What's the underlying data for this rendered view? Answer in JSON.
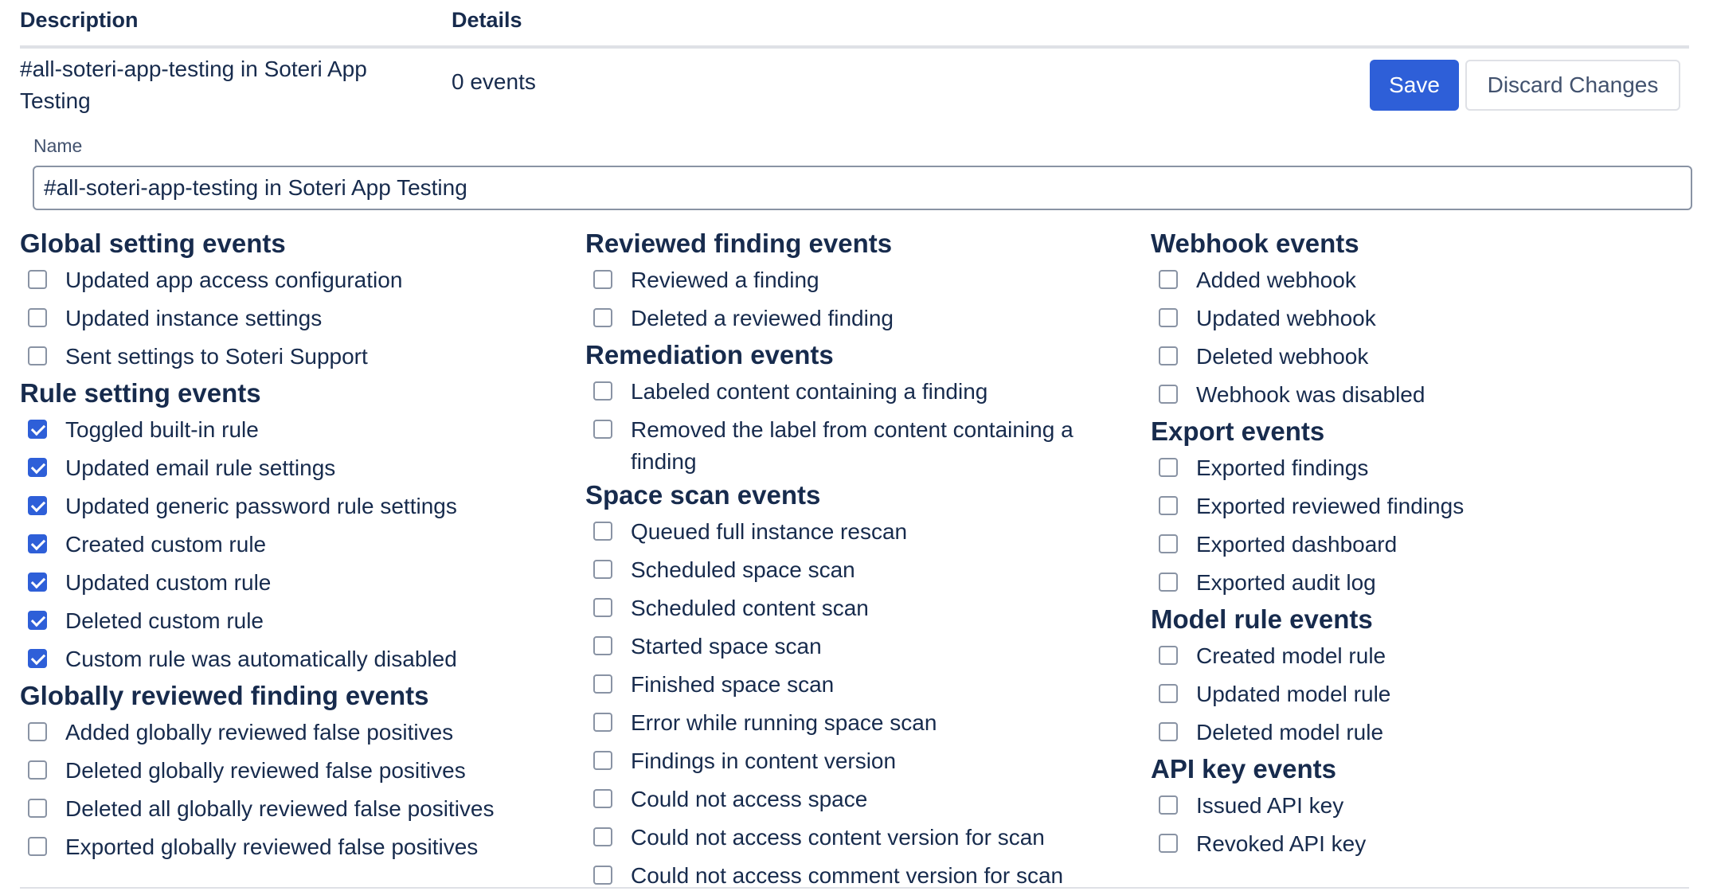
{
  "table": {
    "header_description": "Description",
    "header_details": "Details"
  },
  "row": {
    "description": "#all-soteri-app-testing in Soteri App Testing",
    "details": "0 events",
    "save_label": "Save",
    "discard_label": "Discard Changes"
  },
  "name_field": {
    "label": "Name",
    "value": "#all-soteri-app-testing in Soteri App Testing"
  },
  "accent_color": "#2e5fd8",
  "groups": {
    "global_setting": {
      "title": "Global setting events",
      "items": [
        {
          "label": "Updated app access configuration",
          "checked": false
        },
        {
          "label": "Updated instance settings",
          "checked": false
        },
        {
          "label": "Sent settings to Soteri Support",
          "checked": false
        }
      ]
    },
    "rule_setting": {
      "title": "Rule setting events",
      "items": [
        {
          "label": "Toggled built-in rule",
          "checked": true
        },
        {
          "label": "Updated email rule settings",
          "checked": true
        },
        {
          "label": "Updated generic password rule settings",
          "checked": true
        },
        {
          "label": "Created custom rule",
          "checked": true
        },
        {
          "label": "Updated custom rule",
          "checked": true
        },
        {
          "label": "Deleted custom rule",
          "checked": true
        },
        {
          "label": "Custom rule was automatically disabled",
          "checked": true
        }
      ]
    },
    "globally_reviewed": {
      "title": "Globally reviewed finding events",
      "items": [
        {
          "label": "Added globally reviewed false positives",
          "checked": false
        },
        {
          "label": "Deleted globally reviewed false positives",
          "checked": false
        },
        {
          "label": "Deleted all globally reviewed false positives",
          "checked": false
        },
        {
          "label": "Exported globally reviewed false positives",
          "checked": false
        }
      ]
    },
    "reviewed_finding": {
      "title": "Reviewed finding events",
      "items": [
        {
          "label": "Reviewed a finding",
          "checked": false
        },
        {
          "label": "Deleted a reviewed finding",
          "checked": false
        }
      ]
    },
    "remediation": {
      "title": "Remediation events",
      "items": [
        {
          "label": "Labeled content containing a finding",
          "checked": false
        },
        {
          "label": "Removed the label from content containing a finding",
          "checked": false
        }
      ]
    },
    "space_scan": {
      "title": "Space scan events",
      "items": [
        {
          "label": "Queued full instance rescan",
          "checked": false
        },
        {
          "label": "Scheduled space scan",
          "checked": false
        },
        {
          "label": "Scheduled content scan",
          "checked": false
        },
        {
          "label": "Started space scan",
          "checked": false
        },
        {
          "label": "Finished space scan",
          "checked": false
        },
        {
          "label": "Error while running space scan",
          "checked": false
        },
        {
          "label": "Findings in content version",
          "checked": false
        },
        {
          "label": "Could not access space",
          "checked": false
        },
        {
          "label": "Could not access content version for scan",
          "checked": false
        },
        {
          "label": "Could not access comment version for scan",
          "checked": false
        }
      ]
    },
    "webhook": {
      "title": "Webhook events",
      "items": [
        {
          "label": "Added webhook",
          "checked": false
        },
        {
          "label": "Updated webhook",
          "checked": false
        },
        {
          "label": "Deleted webhook",
          "checked": false
        },
        {
          "label": "Webhook was disabled",
          "checked": false
        }
      ]
    },
    "export": {
      "title": "Export events",
      "items": [
        {
          "label": "Exported findings",
          "checked": false
        },
        {
          "label": "Exported reviewed findings",
          "checked": false
        },
        {
          "label": "Exported dashboard",
          "checked": false
        },
        {
          "label": "Exported audit log",
          "checked": false
        }
      ]
    },
    "model_rule": {
      "title": "Model rule events",
      "items": [
        {
          "label": "Created model rule",
          "checked": false
        },
        {
          "label": "Updated model rule",
          "checked": false
        },
        {
          "label": "Deleted model rule",
          "checked": false
        }
      ]
    },
    "api_key": {
      "title": "API key events",
      "items": [
        {
          "label": "Issued API key",
          "checked": false
        },
        {
          "label": "Revoked API key",
          "checked": false
        }
      ]
    }
  }
}
